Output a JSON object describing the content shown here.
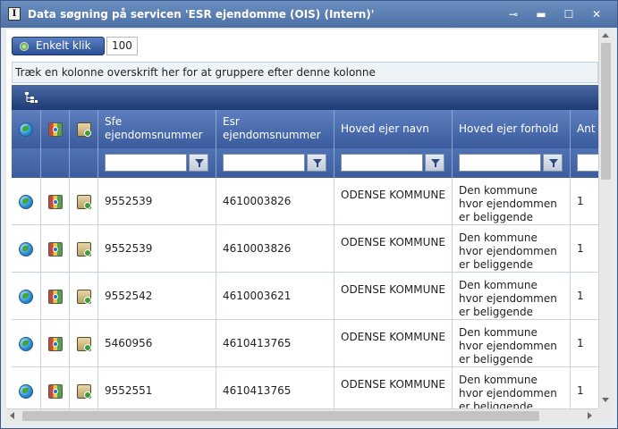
{
  "window": {
    "title": "Data søgning på servicen 'ESR ejendomme (OIS) (Intern)'",
    "app_icon_letter": "I",
    "buttons": {
      "pin": "⊸",
      "minimize": "▬",
      "maximize": "☐",
      "close": "✕"
    }
  },
  "toolbar": {
    "klik_label": "Enkelt klik",
    "count": "100"
  },
  "group_hint": "Træk en kolonne overskrift her for at gruppere efter denne kolonne",
  "columns": [
    {
      "label": ""
    },
    {
      "label": ""
    },
    {
      "label": ""
    },
    {
      "label": "Sfe ejendomsnummer"
    },
    {
      "label": "Esr ejendomsnummer"
    },
    {
      "label": "Hoved ejer navn"
    },
    {
      "label": "Hoved ejer forhold"
    },
    {
      "label": "Ant"
    }
  ],
  "rows": [
    {
      "sfe": "9552539",
      "esr": "4610003826",
      "ejer": "ODENSE KOMMUNE",
      "forhold": "Den kommune hvor ejendommen er beliggende",
      "ant": "1"
    },
    {
      "sfe": "9552539",
      "esr": "4610003826",
      "ejer": "ODENSE KOMMUNE",
      "forhold": "Den kommune hvor ejendommen er beliggende",
      "ant": "1"
    },
    {
      "sfe": "9552542",
      "esr": "4610003621",
      "ejer": "ODENSE KOMMUNE",
      "forhold": "Den kommune hvor ejendommen er beliggende",
      "ant": "1"
    },
    {
      "sfe": "5460956",
      "esr": "4610413765",
      "ejer": "ODENSE KOMMUNE",
      "forhold": "Den kommune hvor ejendommen er beliggende",
      "ant": "1"
    },
    {
      "sfe": "9552551",
      "esr": "4610413765",
      "ejer": "ODENSE KOMMUNE",
      "forhold": "Den kommune hvor ejendommen er beliggende",
      "ant": "1"
    }
  ],
  "icons": {
    "row_icon_1": "globe-icon",
    "row_icon_2": "map-icon",
    "row_icon_3": "house-icon",
    "filter": "funnel-icon",
    "grouping": "tree-icon"
  }
}
